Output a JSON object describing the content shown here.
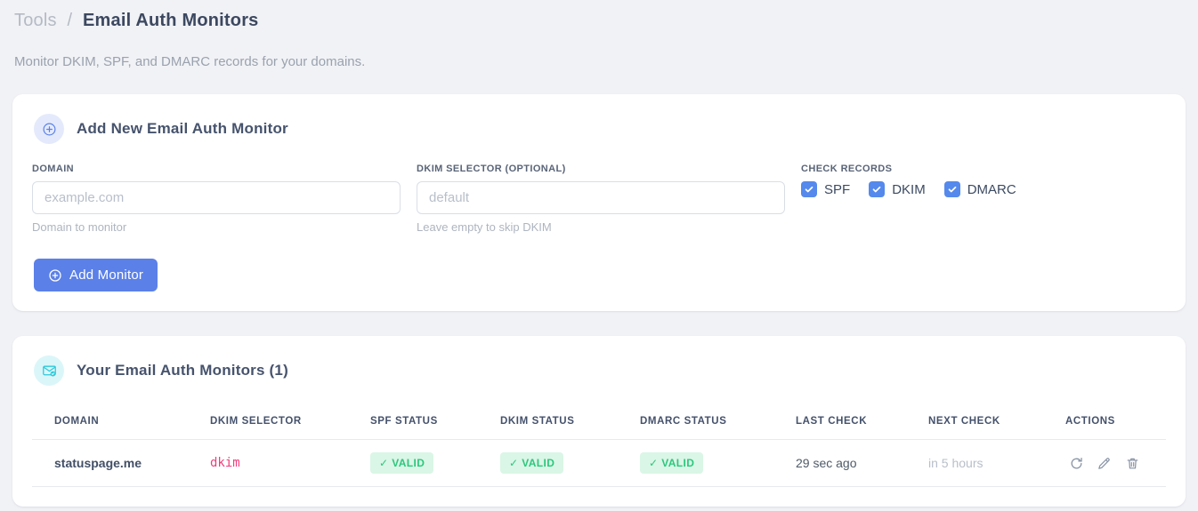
{
  "page": {
    "breadcrumb": {
      "section": "Tools",
      "separator": "/",
      "current": "Email Auth Monitors"
    },
    "subtitle": "Monitor DKIM, SPF, and DMARC records for your domains."
  },
  "add_form": {
    "title": "Add New Email Auth Monitor",
    "domain": {
      "label": "DOMAIN",
      "placeholder": "example.com",
      "value": "",
      "hint": "Domain to monitor"
    },
    "dkim_selector": {
      "label": "DKIM SELECTOR (OPTIONAL)",
      "placeholder": "default",
      "value": "",
      "hint": "Leave empty to skip DKIM"
    },
    "check_records": {
      "label": "CHECK RECORDS",
      "options": [
        {
          "label": "SPF",
          "checked": true
        },
        {
          "label": "DKIM",
          "checked": true
        },
        {
          "label": "DMARC",
          "checked": true
        }
      ]
    },
    "submit_label": "Add Monitor"
  },
  "monitors": {
    "title": "Your Email Auth Monitors (1)",
    "count": 1,
    "columns": [
      "DOMAIN",
      "DKIM SELECTOR",
      "SPF STATUS",
      "DKIM STATUS",
      "DMARC STATUS",
      "LAST CHECK",
      "NEXT CHECK",
      "ACTIONS"
    ],
    "rows": [
      {
        "domain": "statuspage.me",
        "dkim_selector": "dkim",
        "spf_status": "✓ VALID",
        "dkim_status": "✓ VALID",
        "dmarc_status": "✓ VALID",
        "last_check": "29 sec ago",
        "next_check": "in 5 hours"
      }
    ],
    "action_icons": [
      "refresh",
      "edit",
      "delete"
    ]
  },
  "colors": {
    "accent_blue": "#5b80e8",
    "checkbox_blue": "#5589ec",
    "valid_bg": "#daf6e6",
    "valid_text": "#2cc77d",
    "selector_pink": "#ee3d7c",
    "teal_icon": "#2ec9da",
    "page_bg": "#f1f2f6"
  }
}
